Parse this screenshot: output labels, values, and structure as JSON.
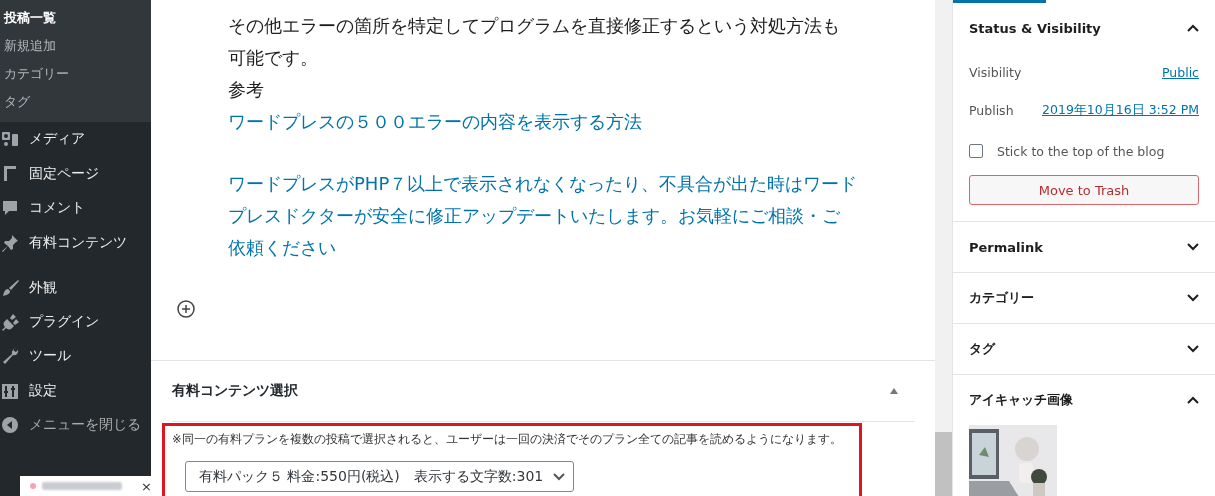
{
  "admin_menu": {
    "submenu": [
      {
        "label": "投稿一覧",
        "selected": true
      },
      {
        "label": "新規追加",
        "selected": false
      },
      {
        "label": "カテゴリー",
        "selected": false
      },
      {
        "label": "タグ",
        "selected": false
      }
    ],
    "items": [
      {
        "label": "メディア"
      },
      {
        "label": "固定ページ"
      },
      {
        "label": "コメント"
      },
      {
        "label": "有料コンテンツ"
      },
      {
        "label": "外観",
        "group_start": true
      },
      {
        "label": "プラグイン"
      },
      {
        "label": "ツール"
      },
      {
        "label": "設定"
      },
      {
        "label": "メニューを閉じる",
        "muted": true
      }
    ]
  },
  "notification": {
    "close": "×"
  },
  "editor": {
    "blocks": [
      {
        "kind": "text",
        "lines": [
          "その他エラーの箇所を特定してプログラムを直接修正するという対処方法も",
          "可能です。"
        ]
      },
      {
        "kind": "text",
        "lines": [
          "参考"
        ]
      },
      {
        "kind": "link",
        "lines": [
          "ワードプレスの５００エラーの内容を表示する方法"
        ]
      },
      {
        "kind": "spacer"
      },
      {
        "kind": "link",
        "lines": [
          "ワードプレスがPHP７以上で表示されなくなったり、不具合が出た時はワード",
          "プレスドクターが安全に修正アップデートいたします。お気軽にご相談・ご",
          "依頼ください"
        ]
      }
    ]
  },
  "meta_box": {
    "title": "有料コンテンツ選択",
    "expanded": true,
    "note": "※同一の有料プランを複数の投稿で選択されると、ユーザーは一回の決済でそのプラン全ての記事を読めるようになります。",
    "select": {
      "value": "有料パック５ 料金:550円(税込)　表示する文字数:301"
    },
    "highlighted": true
  },
  "settings_sidebar": {
    "status": {
      "title": "Status & Visibility",
      "expanded": true,
      "rows": [
        {
          "label": "Visibility",
          "value": "Public"
        },
        {
          "label": "Publish",
          "value": "2019年10月16日 3:52 PM"
        }
      ],
      "sticky": {
        "label": "Stick to the top of the blog",
        "checked": false
      },
      "trash": "Move to Trash"
    },
    "panels": [
      {
        "title": "Permalink",
        "expanded": false
      },
      {
        "title": "カテゴリー",
        "expanded": false
      },
      {
        "title": "タグ",
        "expanded": false
      },
      {
        "title": "アイキャッチ画像",
        "expanded": true
      }
    ]
  }
}
